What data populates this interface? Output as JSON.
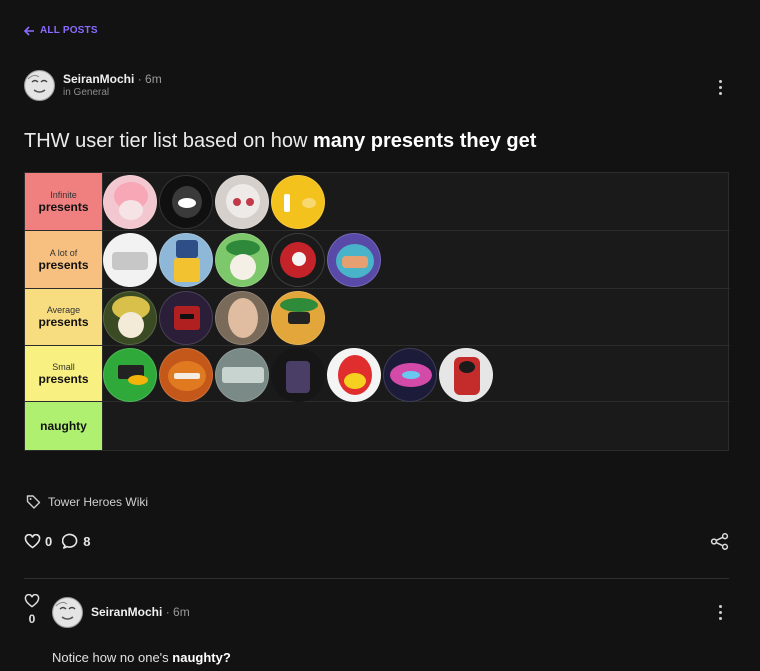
{
  "nav": {
    "back_label": "ALL POSTS"
  },
  "post": {
    "author": "SeiranMochi",
    "separator": "·",
    "time": "6m",
    "category": "in General",
    "title_plain": "THW user tier list based on how ",
    "title_bold": "many presents they get",
    "tag": "Tower Heroes Wiki",
    "likes": "0",
    "comments": "8"
  },
  "tiers": [
    {
      "small": "Infinite",
      "big": "presents",
      "color": "#f08080"
    },
    {
      "small": "A lot of",
      "big": "presents",
      "color": "#f8c080"
    },
    {
      "small": "Average",
      "big": "presents",
      "color": "#f8dc80"
    },
    {
      "small": "Small",
      "big": "presents",
      "color": "#f8f080"
    },
    {
      "small": "",
      "big": "naughty",
      "color": "#b0f070"
    }
  ],
  "reply": {
    "votes": "0",
    "author": "SeiranMochi",
    "separator": "·",
    "time": "6m",
    "body_plain": "Notice how no one's ",
    "body_bold": "naughty?"
  },
  "colors": {
    "accent": "#8b6cff",
    "background": "#121212"
  }
}
